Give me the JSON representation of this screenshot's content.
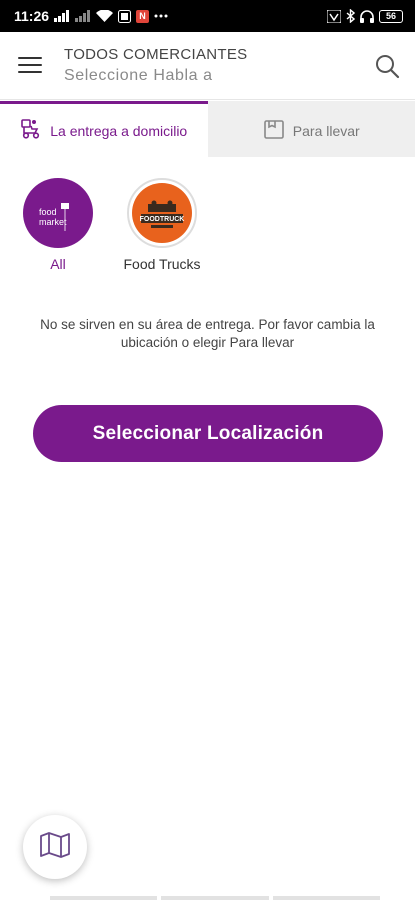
{
  "status_bar": {
    "time": "11:26",
    "battery": "56",
    "notification_badge": "N",
    "icons": [
      "signal-icon",
      "signal-icon",
      "wifi-icon",
      "notification-icon",
      "app-notification-icon",
      "more-icon",
      "vowifi-icon",
      "bluetooth-icon",
      "headphones-icon",
      "battery-icon"
    ]
  },
  "header": {
    "title": "TODOS COMERCIANTES",
    "subtitle": "Seleccione Habla a",
    "menu_icon": "hamburger-menu-icon",
    "search_icon": "search-icon"
  },
  "tabs": [
    {
      "label": "La entrega a domicilio",
      "icon": "delivery-icon",
      "active": true
    },
    {
      "label": "Para llevar",
      "icon": "bag-icon",
      "active": false
    }
  ],
  "categories": [
    {
      "label": "All",
      "logo_text": "food market"
    },
    {
      "label": "Food Trucks",
      "logo_text": "FOODTRUCK"
    }
  ],
  "notice": "No se sirven en su área de entrega. Por favor cambia la ubicación o elegir Para llevar",
  "primary_button": "Seleccionar Localización",
  "colors": {
    "accent": "#7a1a8c",
    "food_truck_orange": "#e8621d"
  }
}
